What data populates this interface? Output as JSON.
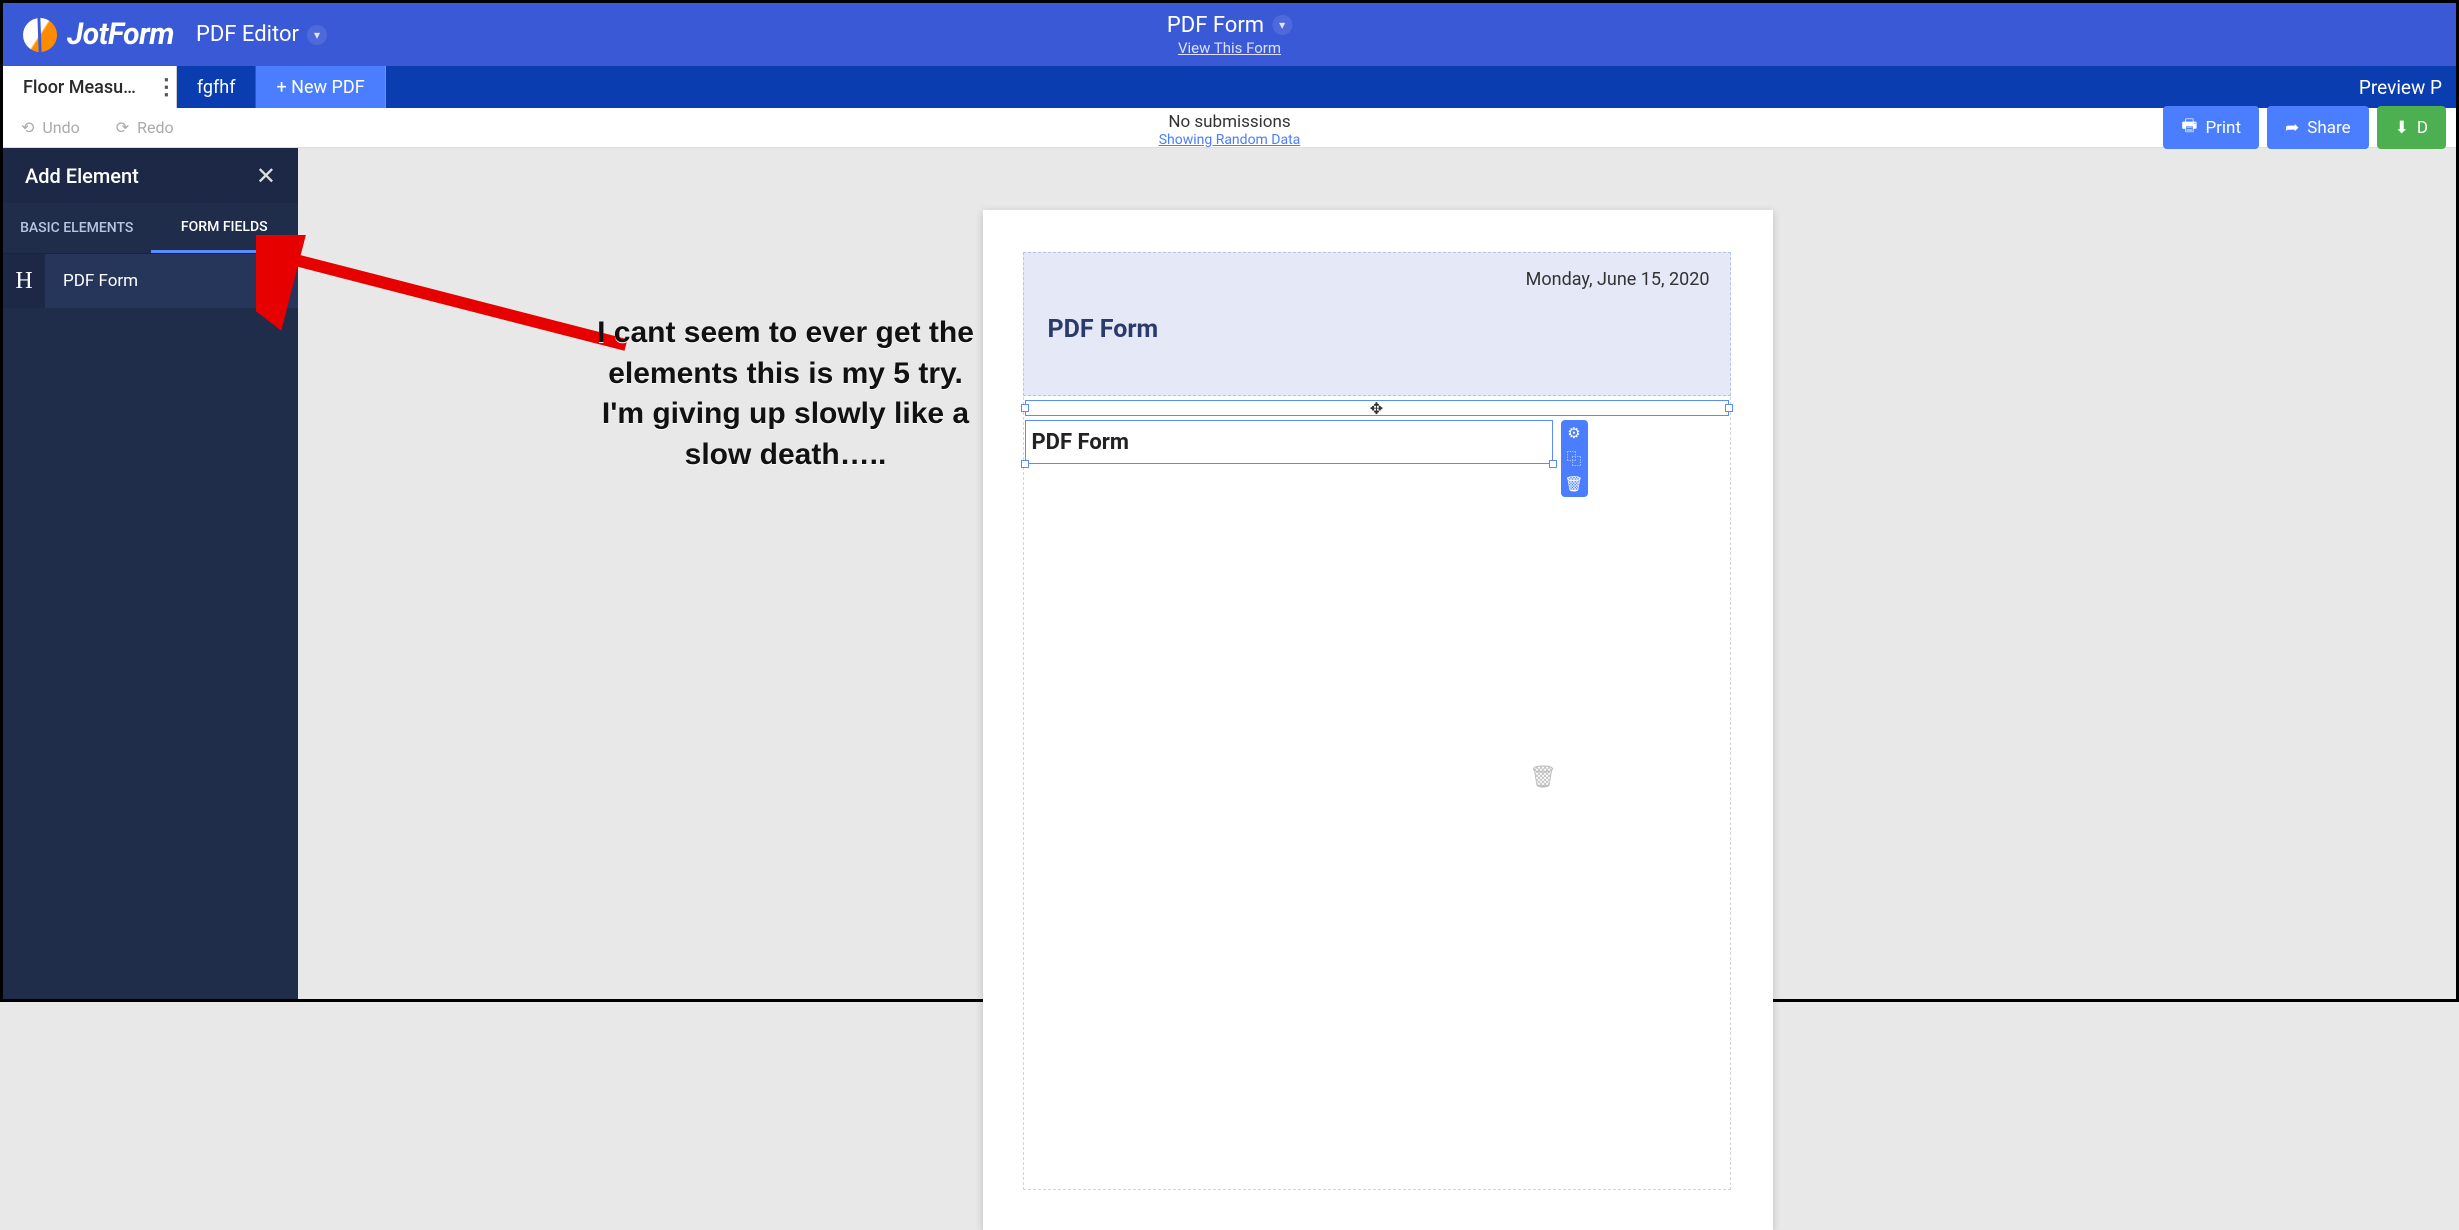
{
  "header": {
    "brand": "JotForm",
    "app_label": "PDF Editor",
    "form_title": "PDF Form",
    "view_link": "View This Form"
  },
  "tabs": {
    "active": "Floor Measu…",
    "second": "fgfhf",
    "new_pdf": "+ New PDF",
    "preview": "Preview P"
  },
  "toolbar": {
    "undo": "Undo",
    "redo": "Redo",
    "no_subs": "No submissions",
    "random": "Showing Random Data",
    "print": "Print",
    "share": "Share",
    "download": "D"
  },
  "panel": {
    "title": "Add Element",
    "tab_basic": "BASIC ELEMENTS",
    "tab_fields": "FORM FIELDS",
    "field_icon": "H",
    "field_label": "PDF Form"
  },
  "page": {
    "date": "Monday, June 15, 2020",
    "header_title": "PDF Form",
    "selected_text": "PDF Form"
  },
  "icons": {
    "move": "✥",
    "gear": "⚙",
    "copy": "⿻",
    "trash": "🗑",
    "download": "⬇",
    "share_arrow": "➦",
    "printer": "🖶",
    "undo_arrow": "⟲",
    "redo_arrow": "⟳"
  },
  "annotation": {
    "text": "I cant seem to ever get the elements this is my 5 try. I'm giving up slowly like a slow death….."
  }
}
